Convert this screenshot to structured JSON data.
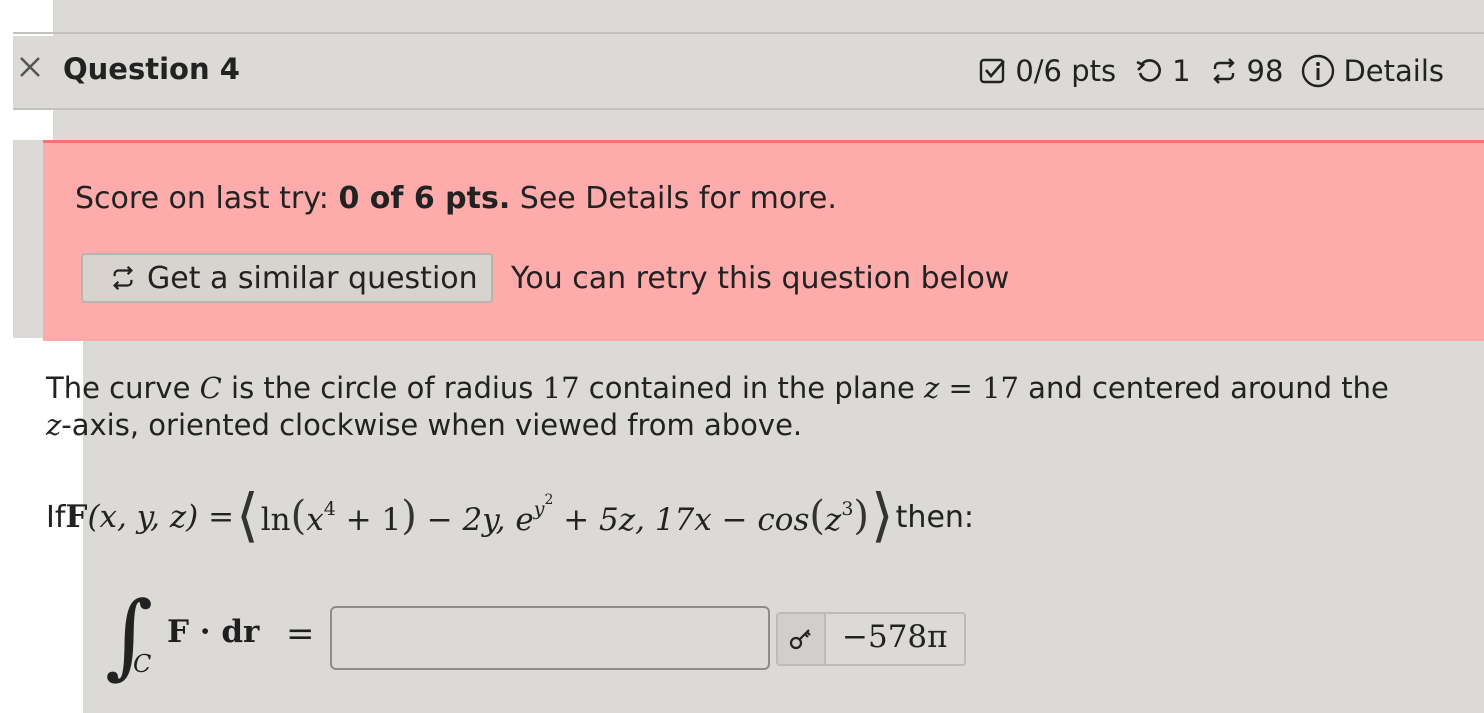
{
  "header": {
    "title": "Question 4",
    "score": "0/6 pts",
    "retries": "1",
    "attempts_left": "98",
    "details_label": "Details"
  },
  "alert": {
    "score_prefix": "Score on last try: ",
    "score_bold": "0 of 6 pts.",
    "score_suffix": " See Details for more.",
    "similar_button": "Get a similar question",
    "retry_text": "You can retry this question below"
  },
  "question": {
    "t1": "The curve ",
    "C": "C",
    "t2": " is the circle of radius ",
    "radius": "17",
    "t3": " contained in the plane ",
    "z": "z",
    "eq": " = ",
    "plane": "17",
    "t4": " and centered around the ",
    "z2": "z",
    "t5": "-axis, oriented clockwise when viewed from above.",
    "if": "If ",
    "then": " then:"
  },
  "field": {
    "lhs": "F(x, y, z) =",
    "ln": "ln",
    "x4": "x",
    "exp4": "4",
    "plus1": " + 1",
    "minus2y": " − 2y, ",
    "e": "e",
    "ey": "y",
    "ey2": "2",
    "plus5z": " + 5z, 17x − cos",
    "z3": "z",
    "exp3": "3"
  },
  "integral": {
    "sub": "C",
    "body": "F · dr",
    "equals": "="
  },
  "answer": {
    "value": "",
    "key_value": "−578π"
  },
  "colors": {
    "alert_bg": "#feabab",
    "alert_border": "#ef7474",
    "page_bg": "#dcdad7"
  }
}
